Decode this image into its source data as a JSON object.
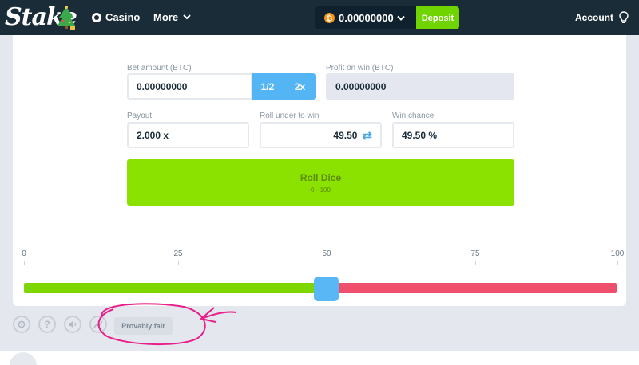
{
  "header": {
    "logo_text": "Stake",
    "nav_casino": "Casino",
    "nav_more": "More",
    "balance": "0.00000000",
    "currency_icon": "bitcoin-icon",
    "deposit_label": "Deposit",
    "account_label": "Account"
  },
  "bet": {
    "amount_label": "Bet amount (BTC)",
    "amount_value": "0.00000000",
    "half_label": "1/2",
    "double_label": "2x",
    "profit_label": "Profit on win (BTC)",
    "profit_value": "0.00000000"
  },
  "stats": {
    "payout_label": "Payout",
    "payout_value": "2.000 x",
    "roll_label": "Roll under to win",
    "roll_value": "49.50",
    "chance_label": "Win chance",
    "chance_value": "49.50 %"
  },
  "roll_button": {
    "label": "Roll Dice",
    "range": "0 - 100"
  },
  "scale": {
    "ticks": [
      "0",
      "25",
      "50",
      "75",
      "100"
    ]
  },
  "slider": {
    "value": 49.5,
    "min": 0,
    "max": 100
  },
  "footer": {
    "icons": [
      "gear-icon",
      "help-icon",
      "volume-icon",
      "stats-icon"
    ],
    "help_glyph": "?",
    "provably_fair_label": "Provably fair"
  },
  "colors": {
    "topbar": "#1a2c38",
    "deposit": "#6fd400",
    "roll_button": "#8be100",
    "slider_win": "#7dd600",
    "slider_lose": "#ef4f6d",
    "accent_blue": "#54b5f5",
    "annotation": "#e8208a"
  }
}
